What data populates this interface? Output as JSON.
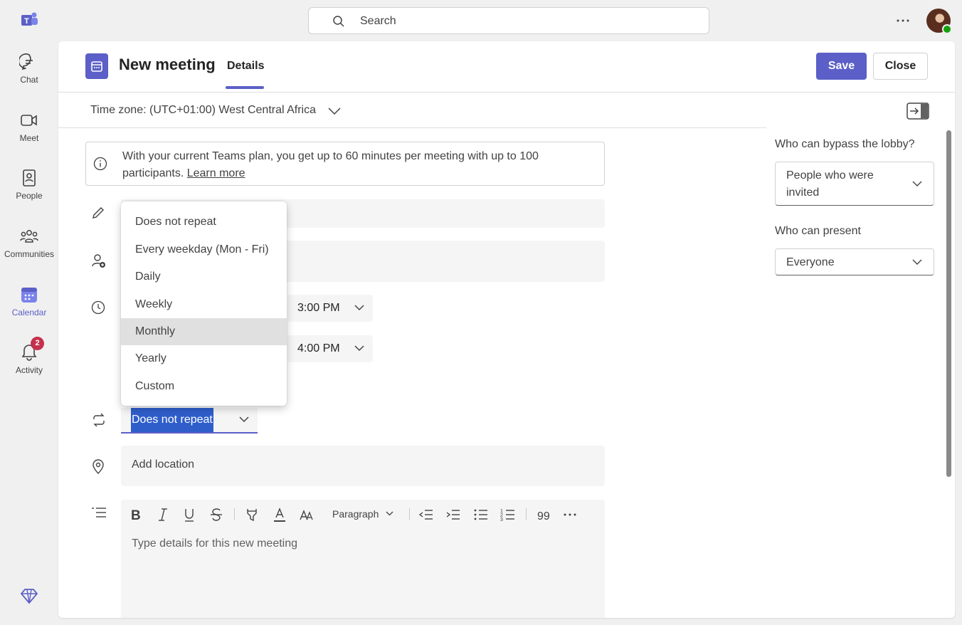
{
  "rail": {
    "items": [
      {
        "label": "Chat"
      },
      {
        "label": "Meet"
      },
      {
        "label": "People"
      },
      {
        "label": "Communities"
      },
      {
        "label": "Calendar"
      },
      {
        "label": "Activity",
        "badge": "2"
      }
    ],
    "accent": "#5b5fc7"
  },
  "search": {
    "placeholder": "Search"
  },
  "header": {
    "title": "New meeting",
    "tab": "Details",
    "save_label": "Save",
    "close_label": "Close"
  },
  "timezone": {
    "label": "Time zone: (UTC+01:00) West Central Africa"
  },
  "info": {
    "text": "With your current Teams plan, you get up to 60 minutes per meeting with up to 100 participants.",
    "link": "Learn more"
  },
  "times": {
    "start": "3:00 PM",
    "end": "4:00 PM"
  },
  "repeat": {
    "value": "Does not repeat"
  },
  "location": {
    "placeholder": "Add location"
  },
  "editor": {
    "paragraph": "Paragraph",
    "placeholder": "Type details for this new meeting"
  },
  "side": {
    "lobby_label": "Who can bypass the lobby?",
    "lobby_value": "People who were invited",
    "present_label": "Who can present",
    "present_value": "Everyone"
  },
  "menu": {
    "items": [
      "Does not repeat",
      "Every weekday (Mon - Fri)",
      "Daily",
      "Weekly",
      "Monthly",
      "Yearly",
      "Custom"
    ],
    "hovered": "Monthly"
  }
}
